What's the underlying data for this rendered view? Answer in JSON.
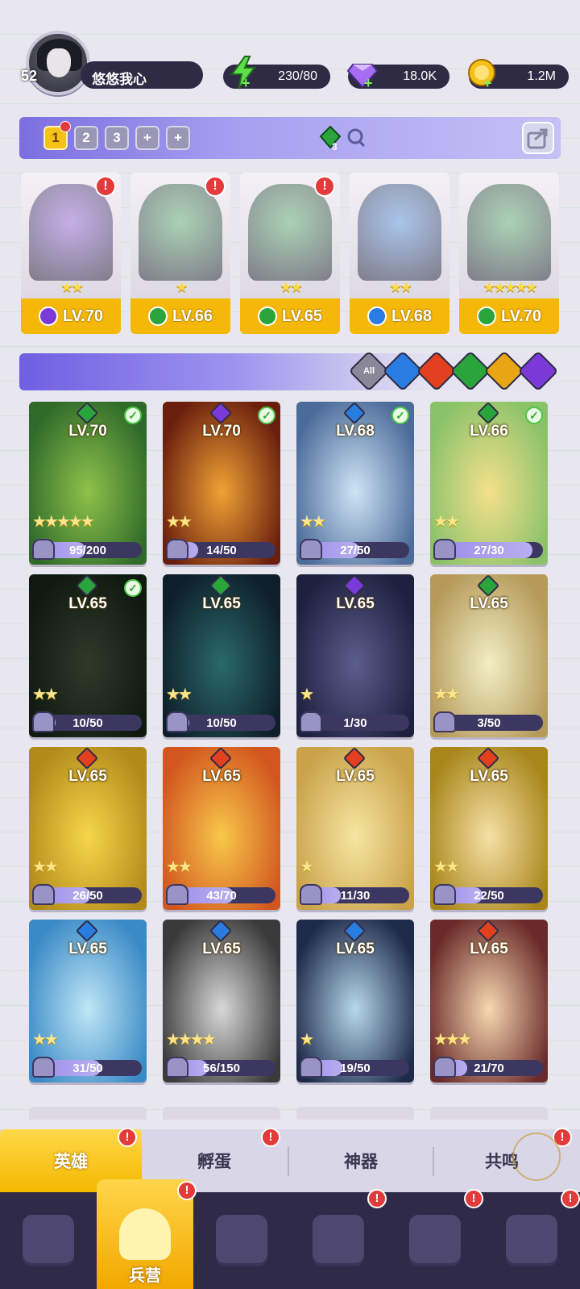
{
  "player": {
    "level": "52",
    "name": "悠悠我心"
  },
  "resources": {
    "energy": "230/80",
    "gems": "18.0K",
    "gold": "1.2M"
  },
  "teams": {
    "slots": [
      "1",
      "2",
      "3",
      "+",
      "+"
    ],
    "active": "1",
    "lineup_count": "3"
  },
  "formation": [
    {
      "level": "LV.70",
      "element": "dark",
      "stars": "★★",
      "alert": true
    },
    {
      "level": "LV.66",
      "element": "nature",
      "stars": "★",
      "alert": true
    },
    {
      "level": "LV.65",
      "element": "nature",
      "stars": "★★",
      "alert": true
    },
    {
      "level": "LV.68",
      "element": "water",
      "stars": "★★",
      "alert": false
    },
    {
      "level": "LV.70",
      "element": "nature",
      "stars": "★★★★★",
      "alert": false
    }
  ],
  "filters": {
    "all_label": "All",
    "elements": [
      "water",
      "fire",
      "nature",
      "light",
      "dark"
    ]
  },
  "heroes": [
    {
      "level": "LV.70",
      "element": "nature",
      "stars": "★★★★★",
      "progress": "95/200",
      "fill": 0.475,
      "owned_check": true,
      "art": [
        "#8ec24a",
        "#2f6a2a"
      ]
    },
    {
      "level": "LV.70",
      "element": "dark",
      "stars": "★★",
      "progress": "14/50",
      "fill": 0.28,
      "owned_check": true,
      "art": [
        "#f0a234",
        "#6a1f0e"
      ]
    },
    {
      "level": "LV.68",
      "element": "water",
      "stars": "★★",
      "progress": "27/50",
      "fill": 0.54,
      "owned_check": true,
      "art": [
        "#cfe4f4",
        "#4b6b9a"
      ]
    },
    {
      "level": "LV.66",
      "element": "nature",
      "stars": "★★",
      "progress": "27/30",
      "fill": 0.9,
      "owned_check": true,
      "art": [
        "#f4e08a",
        "#8ac26a"
      ]
    },
    {
      "level": "LV.65",
      "element": "nature",
      "stars": "★★",
      "progress": "10/50",
      "fill": 0.2,
      "owned_check": true,
      "art": [
        "#2f3a2a",
        "#0e1a10"
      ]
    },
    {
      "level": "LV.65",
      "element": "nature",
      "stars": "★★",
      "progress": "10/50",
      "fill": 0.2,
      "owned_check": false,
      "art": [
        "#2a6a6a",
        "#0e1e2a"
      ]
    },
    {
      "level": "LV.65",
      "element": "dark",
      "stars": "★",
      "progress": "1/30",
      "fill": 0.033,
      "owned_check": false,
      "art": [
        "#5a5e8a",
        "#1e2040"
      ]
    },
    {
      "level": "LV.65",
      "element": "nature",
      "stars": "★★",
      "progress": "3/50",
      "fill": 0.06,
      "owned_check": false,
      "art": [
        "#f2eec6",
        "#b59a5a"
      ]
    },
    {
      "level": "LV.65",
      "element": "fire",
      "stars": "★★",
      "progress": "26/50",
      "fill": 0.52,
      "owned_check": false,
      "art": [
        "#f6d64a",
        "#b28a1a"
      ]
    },
    {
      "level": "LV.65",
      "element": "fire",
      "stars": "★★",
      "progress": "43/70",
      "fill": 0.614,
      "owned_check": false,
      "art": [
        "#f8c84a",
        "#d2561e"
      ]
    },
    {
      "level": "LV.65",
      "element": "fire",
      "stars": "★",
      "progress": "11/30",
      "fill": 0.367,
      "owned_check": false,
      "art": [
        "#f6e6a0",
        "#c9a24a"
      ]
    },
    {
      "level": "LV.65",
      "element": "fire",
      "stars": "★★",
      "progress": "22/50",
      "fill": 0.44,
      "owned_check": false,
      "art": [
        "#f6e0a6",
        "#a8861a"
      ]
    },
    {
      "level": "LV.65",
      "element": "water",
      "stars": "★★",
      "progress": "31/50",
      "fill": 0.62,
      "owned_check": false,
      "art": [
        "#bfe6f6",
        "#3a8ac6"
      ]
    },
    {
      "level": "LV.65",
      "element": "water",
      "stars": "★★★★",
      "progress": "56/150",
      "fill": 0.373,
      "owned_check": false,
      "art": [
        "#d8d8d8",
        "#3a3a3a"
      ]
    },
    {
      "level": "LV.65",
      "element": "water",
      "stars": "★",
      "progress": "19/50",
      "fill": 0.38,
      "owned_check": false,
      "art": [
        "#b6d8ee",
        "#1e2a4a"
      ]
    },
    {
      "level": "LV.65",
      "element": "fire",
      "stars": "★★★",
      "progress": "21/70",
      "fill": 0.3,
      "owned_check": false,
      "art": [
        "#f6d8b0",
        "#6a2a2a"
      ]
    }
  ],
  "subtabs": [
    {
      "label": "英雄",
      "active": true,
      "alert": true
    },
    {
      "label": "孵蛋",
      "active": false,
      "alert": true
    },
    {
      "label": "神器",
      "active": false,
      "alert": false
    },
    {
      "label": "共鸣",
      "active": false,
      "alert": true
    }
  ],
  "bottomnav": [
    {
      "id": "cards",
      "label": "",
      "alert": false
    },
    {
      "id": "barracks",
      "label": "兵营",
      "alert": true,
      "active": true
    },
    {
      "id": "book",
      "label": "",
      "alert": false
    },
    {
      "id": "castle",
      "label": "",
      "alert": true
    },
    {
      "id": "guild",
      "label": "",
      "alert": true
    },
    {
      "id": "events",
      "label": "",
      "alert": true
    }
  ],
  "colors": {
    "accent": "#f5b808",
    "panel": "#2f2b45",
    "alert": "#e23b3b",
    "dark": "#7b3ad8",
    "nature": "#2aa53c",
    "water": "#2a7de0",
    "fire": "#e2401e",
    "light": "#e8a614"
  }
}
